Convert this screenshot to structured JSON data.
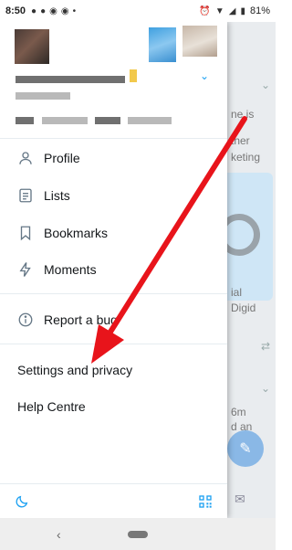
{
  "status_bar": {
    "time": "8:50",
    "battery": "81%"
  },
  "drawer": {
    "menu": [
      {
        "id": "profile",
        "label": "Profile",
        "icon": "person-icon"
      },
      {
        "id": "lists",
        "label": "Lists",
        "icon": "list-icon"
      },
      {
        "id": "bookmarks",
        "label": "Bookmarks",
        "icon": "bookmark-icon"
      },
      {
        "id": "moments",
        "label": "Moments",
        "icon": "lightning-icon"
      }
    ],
    "report_bug": "Report a bug",
    "settings": "Settings and privacy",
    "help": "Help Centre",
    "footer_icons": [
      "moon-icon",
      "qr-code-icon"
    ]
  },
  "feed": {
    "snippets": [
      "ne is",
      "ther",
      "keting",
      "ial",
      "Digid",
      "6m",
      "d an"
    ]
  },
  "colors": {
    "accent": "#1da1f2",
    "annotation": "#e8141b",
    "icon_grey": "#657786"
  }
}
